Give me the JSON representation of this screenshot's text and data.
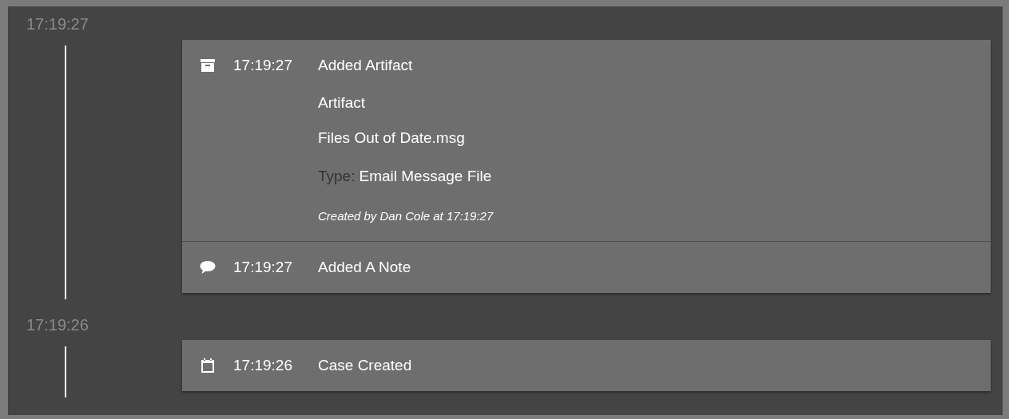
{
  "groups": [
    {
      "time": "17:19:27",
      "entries": [
        {
          "kind": "artifact",
          "time": "17:19:27",
          "title": "Added Artifact",
          "details": {
            "heading": "Artifact",
            "name": "Files Out of Date.msg",
            "type_label": "Type:",
            "type_value": "Email Message File",
            "created": "Created by Dan Cole at 17:19:27"
          }
        },
        {
          "kind": "note",
          "time": "17:19:27",
          "title": "Added A Note"
        }
      ]
    },
    {
      "time": "17:19:26",
      "entries": [
        {
          "kind": "calendar",
          "time": "17:19:26",
          "title": "Case Created"
        }
      ]
    }
  ]
}
